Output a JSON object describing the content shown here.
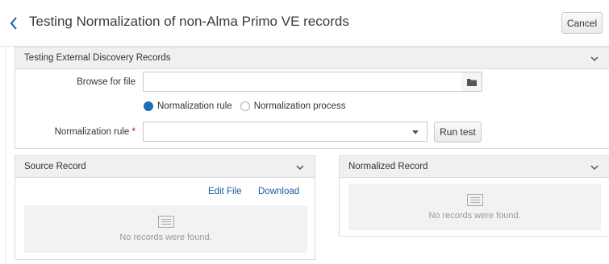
{
  "header": {
    "title": "Testing Normalization of non-Alma Primo VE records",
    "back_icon": "chevron-left-icon",
    "cancel_label": "Cancel"
  },
  "discovery_panel": {
    "title": "Testing External Discovery Records",
    "browse_label": "Browse for file",
    "browse_value": "",
    "folder_icon": "folder-icon",
    "radio_options": [
      {
        "label": "Normalization rule",
        "selected": true
      },
      {
        "label": "Normalization process",
        "selected": false
      }
    ],
    "rule_label": "Normalization rule",
    "rule_required_mark": "*",
    "rule_value": "",
    "run_test_label": "Run test"
  },
  "source_panel": {
    "title": "Source Record",
    "edit_file_label": "Edit File",
    "download_label": "Download",
    "empty_text": "No records were found."
  },
  "normalized_panel": {
    "title": "Normalized Record",
    "empty_text": "No records were found."
  },
  "colors": {
    "accent": "#1d6fb8",
    "link": "#1d5aa5",
    "required": "#d0021b",
    "panel_header": "#f0f0f0"
  }
}
